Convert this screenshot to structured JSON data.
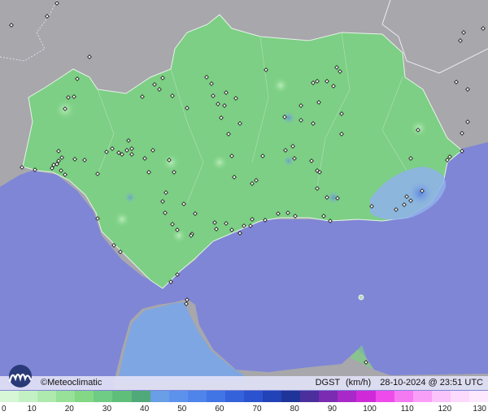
{
  "brand": {
    "copyright": "©",
    "name": "Meteoclimatic"
  },
  "header": {
    "variable": "DGST",
    "unit": "(km/h)",
    "datetime": "28-10-2024 @ 23:51 UTC"
  },
  "legend": {
    "ticks": [
      "0",
      "10",
      "20",
      "30",
      "40",
      "50",
      "60",
      "70",
      "80",
      "90",
      "100",
      "110",
      "120",
      "130"
    ],
    "max_value": 130,
    "colors": [
      "#d6f6d6",
      "#c4f1c4",
      "#aeeaae",
      "#98e198",
      "#84d784",
      "#6fcc84",
      "#5fbf7a",
      "#50a978",
      "#6a9ee6",
      "#5c92ec",
      "#4f84ea",
      "#4174e4",
      "#3462da",
      "#2b52cf",
      "#2242b8",
      "#1f3498",
      "#4b2f9c",
      "#7a2bb2",
      "#a829c8",
      "#d02ad8",
      "#ee4bea",
      "#f57af2",
      "#fa9ff7",
      "#fbc3fa",
      "#fdd9fc",
      "#fde8fd"
    ]
  },
  "colors": {
    "sea": "#7f86d6",
    "land_other": "#a7a7ac",
    "region_land": "#7ccf84",
    "gust_high": "#86a8e8",
    "station": "#111111"
  }
}
